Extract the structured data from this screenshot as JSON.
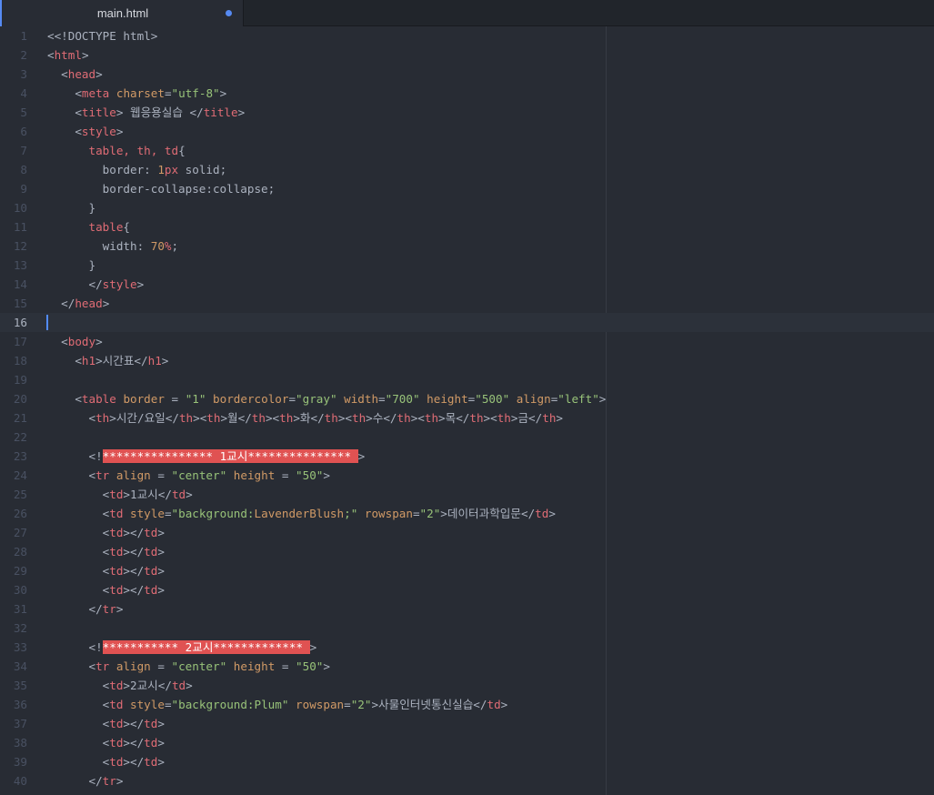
{
  "tab": {
    "title": "main.html",
    "modified": true
  },
  "colors": {
    "accent": "#568af2",
    "tag": "#e06c75",
    "attribute": "#d19a66",
    "string": "#98c379",
    "text": "#abb2bf",
    "invalid_highlight": "#e05252"
  },
  "editor": {
    "cursor_line": 16,
    "lines": [
      {
        "number": "1",
        "tokens": [
          [
            "<<!DOCTYPE html>",
            "text"
          ]
        ]
      },
      {
        "number": "2",
        "tokens": [
          [
            "<",
            "text"
          ],
          [
            "html",
            "tag"
          ],
          [
            ">",
            "text"
          ]
        ]
      },
      {
        "number": "3",
        "tokens": [
          [
            "  <",
            "text"
          ],
          [
            "head",
            "tag"
          ],
          [
            ">",
            "text"
          ]
        ]
      },
      {
        "number": "4",
        "tokens": [
          [
            "    <",
            "text"
          ],
          [
            "meta",
            "tag"
          ],
          [
            " ",
            "text"
          ],
          [
            "charset",
            "attr"
          ],
          [
            "=",
            "text"
          ],
          [
            "\"utf-8\"",
            "str"
          ],
          [
            ">",
            "text"
          ]
        ]
      },
      {
        "number": "5",
        "tokens": [
          [
            "    <",
            "text"
          ],
          [
            "title",
            "tag"
          ],
          [
            "> 웹응용실습 </",
            "text"
          ],
          [
            "title",
            "tag"
          ],
          [
            ">",
            "text"
          ]
        ]
      },
      {
        "number": "6",
        "tokens": [
          [
            "    <",
            "text"
          ],
          [
            "style",
            "tag"
          ],
          [
            ">",
            "text"
          ]
        ]
      },
      {
        "number": "7",
        "tokens": [
          [
            "      ",
            "text"
          ],
          [
            "table, th, td",
            "sel"
          ],
          [
            "{",
            "text"
          ]
        ]
      },
      {
        "number": "8",
        "tokens": [
          [
            "        border: ",
            "text"
          ],
          [
            "1",
            "num"
          ],
          [
            "px",
            "unit"
          ],
          [
            " solid;",
            "text"
          ]
        ]
      },
      {
        "number": "9",
        "tokens": [
          [
            "        border-collapse:collapse;",
            "text"
          ]
        ]
      },
      {
        "number": "10",
        "tokens": [
          [
            "      }",
            "text"
          ]
        ]
      },
      {
        "number": "11",
        "tokens": [
          [
            "      ",
            "text"
          ],
          [
            "table",
            "sel"
          ],
          [
            "{",
            "text"
          ]
        ]
      },
      {
        "number": "12",
        "tokens": [
          [
            "        width: ",
            "text"
          ],
          [
            "70",
            "num"
          ],
          [
            "%",
            "unit"
          ],
          [
            ";",
            "text"
          ]
        ]
      },
      {
        "number": "13",
        "tokens": [
          [
            "      }",
            "text"
          ]
        ]
      },
      {
        "number": "14",
        "tokens": [
          [
            "      </",
            "text"
          ],
          [
            "style",
            "tag"
          ],
          [
            ">",
            "text"
          ]
        ]
      },
      {
        "number": "15",
        "tokens": [
          [
            "  </",
            "text"
          ],
          [
            "head",
            "tag"
          ],
          [
            ">",
            "text"
          ]
        ]
      },
      {
        "number": "16",
        "tokens": []
      },
      {
        "number": "17",
        "tokens": [
          [
            "  <",
            "text"
          ],
          [
            "body",
            "tag"
          ],
          [
            ">",
            "text"
          ]
        ]
      },
      {
        "number": "18",
        "tokens": [
          [
            "    <",
            "text"
          ],
          [
            "h1",
            "tag"
          ],
          [
            ">시간표</",
            "text"
          ],
          [
            "h1",
            "tag"
          ],
          [
            ">",
            "text"
          ]
        ]
      },
      {
        "number": "19",
        "tokens": []
      },
      {
        "number": "20",
        "tokens": [
          [
            "    <",
            "text"
          ],
          [
            "table",
            "tag"
          ],
          [
            " ",
            "text"
          ],
          [
            "border",
            "attr"
          ],
          [
            " = ",
            "text"
          ],
          [
            "\"1\"",
            "str"
          ],
          [
            " ",
            "text"
          ],
          [
            "bordercolor",
            "attr"
          ],
          [
            "=",
            "text"
          ],
          [
            "\"gray\"",
            "str"
          ],
          [
            " ",
            "text"
          ],
          [
            "width",
            "attr"
          ],
          [
            "=",
            "text"
          ],
          [
            "\"700\"",
            "str"
          ],
          [
            " ",
            "text"
          ],
          [
            "height",
            "attr"
          ],
          [
            "=",
            "text"
          ],
          [
            "\"500\"",
            "str"
          ],
          [
            " ",
            "text"
          ],
          [
            "align",
            "attr"
          ],
          [
            "=",
            "text"
          ],
          [
            "\"left\"",
            "str"
          ],
          [
            ">",
            "text"
          ]
        ]
      },
      {
        "number": "21",
        "tokens": [
          [
            "      <",
            "text"
          ],
          [
            "th",
            "tag"
          ],
          [
            ">시간/요일</",
            "text"
          ],
          [
            "th",
            "tag"
          ],
          [
            "><",
            "text"
          ],
          [
            "th",
            "tag"
          ],
          [
            ">월</",
            "text"
          ],
          [
            "th",
            "tag"
          ],
          [
            "><",
            "text"
          ],
          [
            "th",
            "tag"
          ],
          [
            ">화</",
            "text"
          ],
          [
            "th",
            "tag"
          ],
          [
            "><",
            "text"
          ],
          [
            "th",
            "tag"
          ],
          [
            ">수</",
            "text"
          ],
          [
            "th",
            "tag"
          ],
          [
            "><",
            "text"
          ],
          [
            "th",
            "tag"
          ],
          [
            ">목</",
            "text"
          ],
          [
            "th",
            "tag"
          ],
          [
            "><",
            "text"
          ],
          [
            "th",
            "tag"
          ],
          [
            ">금</",
            "text"
          ],
          [
            "th",
            "tag"
          ],
          [
            ">",
            "text"
          ]
        ]
      },
      {
        "number": "22",
        "tokens": []
      },
      {
        "number": "23",
        "tokens": [
          [
            "      <!",
            "text"
          ],
          [
            "**************** 1교시*************** ",
            "err"
          ],
          [
            ">",
            "text"
          ]
        ]
      },
      {
        "number": "24",
        "tokens": [
          [
            "      <",
            "text"
          ],
          [
            "tr",
            "tag"
          ],
          [
            " ",
            "text"
          ],
          [
            "align",
            "attr"
          ],
          [
            " = ",
            "text"
          ],
          [
            "\"center\"",
            "str"
          ],
          [
            " ",
            "text"
          ],
          [
            "height",
            "attr"
          ],
          [
            " = ",
            "text"
          ],
          [
            "\"50\"",
            "str"
          ],
          [
            ">",
            "text"
          ]
        ]
      },
      {
        "number": "25",
        "tokens": [
          [
            "        <",
            "text"
          ],
          [
            "td",
            "tag"
          ],
          [
            ">1교시</",
            "text"
          ],
          [
            "td",
            "tag"
          ],
          [
            ">",
            "text"
          ]
        ]
      },
      {
        "number": "26",
        "tokens": [
          [
            "        <",
            "text"
          ],
          [
            "td",
            "tag"
          ],
          [
            " ",
            "text"
          ],
          [
            "style",
            "attr"
          ],
          [
            "=",
            "text"
          ],
          [
            "\"background:",
            "str"
          ],
          [
            "LavenderBlush",
            "attr"
          ],
          [
            ";\"",
            "str"
          ],
          [
            " ",
            "text"
          ],
          [
            "rowspan",
            "attr"
          ],
          [
            "=",
            "text"
          ],
          [
            "\"2\"",
            "str"
          ],
          [
            ">데이터과학입문</",
            "text"
          ],
          [
            "td",
            "tag"
          ],
          [
            ">",
            "text"
          ]
        ]
      },
      {
        "number": "27",
        "tokens": [
          [
            "        <",
            "text"
          ],
          [
            "td",
            "tag"
          ],
          [
            "></",
            "text"
          ],
          [
            "td",
            "tag"
          ],
          [
            ">",
            "text"
          ]
        ]
      },
      {
        "number": "28",
        "tokens": [
          [
            "        <",
            "text"
          ],
          [
            "td",
            "tag"
          ],
          [
            "></",
            "text"
          ],
          [
            "td",
            "tag"
          ],
          [
            ">",
            "text"
          ]
        ]
      },
      {
        "number": "29",
        "tokens": [
          [
            "        <",
            "text"
          ],
          [
            "td",
            "tag"
          ],
          [
            "></",
            "text"
          ],
          [
            "td",
            "tag"
          ],
          [
            ">",
            "text"
          ]
        ]
      },
      {
        "number": "30",
        "tokens": [
          [
            "        <",
            "text"
          ],
          [
            "td",
            "tag"
          ],
          [
            "></",
            "text"
          ],
          [
            "td",
            "tag"
          ],
          [
            ">",
            "text"
          ]
        ]
      },
      {
        "number": "31",
        "tokens": [
          [
            "      </",
            "text"
          ],
          [
            "tr",
            "tag"
          ],
          [
            ">",
            "text"
          ]
        ]
      },
      {
        "number": "32",
        "tokens": []
      },
      {
        "number": "33",
        "tokens": [
          [
            "      <!",
            "text"
          ],
          [
            "*********** 2교시************* ",
            "err"
          ],
          [
            ">",
            "text"
          ]
        ]
      },
      {
        "number": "34",
        "tokens": [
          [
            "      <",
            "text"
          ],
          [
            "tr",
            "tag"
          ],
          [
            " ",
            "text"
          ],
          [
            "align",
            "attr"
          ],
          [
            " = ",
            "text"
          ],
          [
            "\"center\"",
            "str"
          ],
          [
            " ",
            "text"
          ],
          [
            "height",
            "attr"
          ],
          [
            " = ",
            "text"
          ],
          [
            "\"50\"",
            "str"
          ],
          [
            ">",
            "text"
          ]
        ]
      },
      {
        "number": "35",
        "tokens": [
          [
            "        <",
            "text"
          ],
          [
            "td",
            "tag"
          ],
          [
            ">2교시</",
            "text"
          ],
          [
            "td",
            "tag"
          ],
          [
            ">",
            "text"
          ]
        ]
      },
      {
        "number": "36",
        "tokens": [
          [
            "        <",
            "text"
          ],
          [
            "td",
            "tag"
          ],
          [
            " ",
            "text"
          ],
          [
            "style",
            "attr"
          ],
          [
            "=",
            "text"
          ],
          [
            "\"background:Plum\"",
            "str"
          ],
          [
            " ",
            "text"
          ],
          [
            "rowspan",
            "attr"
          ],
          [
            "=",
            "text"
          ],
          [
            "\"2\"",
            "str"
          ],
          [
            ">사물인터넷통신실습</",
            "text"
          ],
          [
            "td",
            "tag"
          ],
          [
            ">",
            "text"
          ]
        ]
      },
      {
        "number": "37",
        "tokens": [
          [
            "        <",
            "text"
          ],
          [
            "td",
            "tag"
          ],
          [
            "></",
            "text"
          ],
          [
            "td",
            "tag"
          ],
          [
            ">",
            "text"
          ]
        ]
      },
      {
        "number": "38",
        "tokens": [
          [
            "        <",
            "text"
          ],
          [
            "td",
            "tag"
          ],
          [
            "></",
            "text"
          ],
          [
            "td",
            "tag"
          ],
          [
            ">",
            "text"
          ]
        ]
      },
      {
        "number": "39",
        "tokens": [
          [
            "        <",
            "text"
          ],
          [
            "td",
            "tag"
          ],
          [
            "></",
            "text"
          ],
          [
            "td",
            "tag"
          ],
          [
            ">",
            "text"
          ]
        ]
      },
      {
        "number": "40",
        "tokens": [
          [
            "      </",
            "text"
          ],
          [
            "tr",
            "tag"
          ],
          [
            ">",
            "text"
          ]
        ]
      }
    ]
  }
}
